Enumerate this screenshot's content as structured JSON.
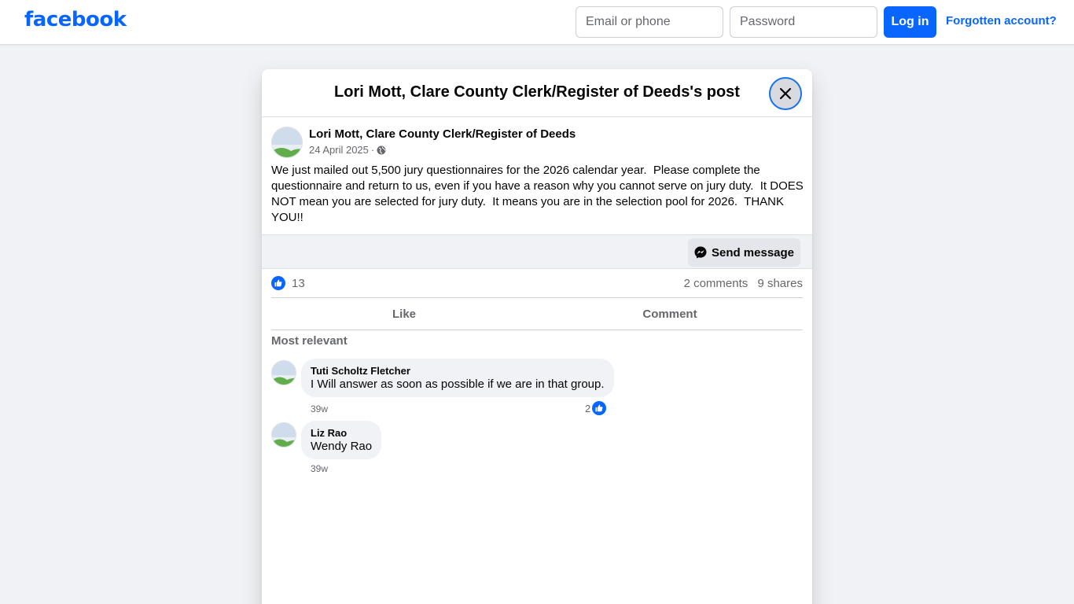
{
  "header": {
    "logo": "facebook",
    "email_placeholder": "Email or phone",
    "password_placeholder": "Password",
    "login_label": "Log in",
    "forgot_label": "Forgotten account?"
  },
  "modal": {
    "title": "Lori Mott, Clare County Clerk/Register of Deeds's post"
  },
  "post": {
    "author": "Lori Mott, Clare County Clerk/Register of Deeds",
    "date": "24 April 2025",
    "separator": "·",
    "audience_icon": "globe-icon",
    "text": "We just mailed out 5,500 jury questionnaires for the 2026 calendar year.  Please complete the questionnaire and return to us, even if you have a reason why you cannot serve on jury duty.  It DOES NOT mean you are selected for jury duty.  It means you are in the selection pool for 2026.  THANK YOU!!",
    "send_message_label": "Send message",
    "like_count": "13",
    "comments_count": "2 comments",
    "shares_count": "9 shares"
  },
  "actions": {
    "like": "Like",
    "comment": "Comment"
  },
  "comments_section": {
    "sort_label": "Most relevant",
    "comments": [
      {
        "name": "Tuti Scholtz Fletcher",
        "text": "I Will answer as soon as possible if we are in that group.",
        "time": "39w",
        "reactions": "2"
      },
      {
        "name": "Liz Rao",
        "text": "Wendy Rao",
        "time": "39w"
      }
    ]
  },
  "colors": {
    "brand": "#0866ff",
    "background": "#f0f2f5",
    "secondary_text": "#65676b"
  }
}
